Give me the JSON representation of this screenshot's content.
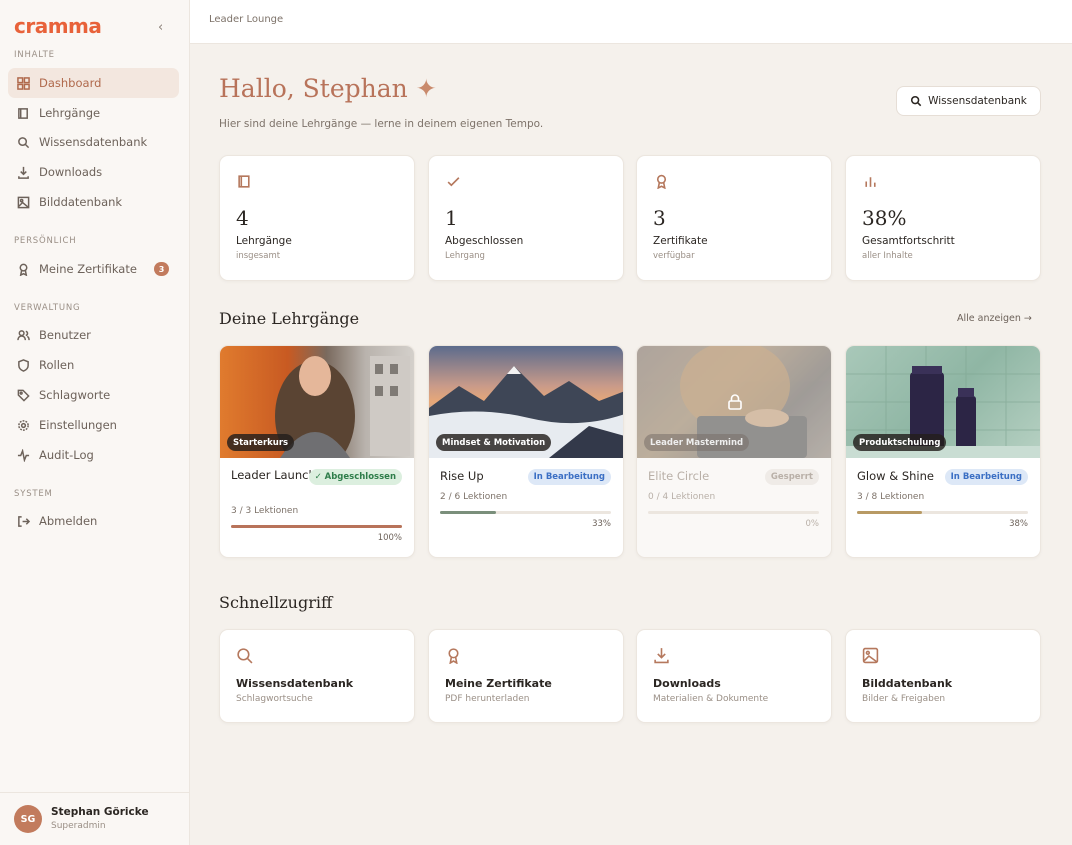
{
  "app": {
    "logo": "cramma",
    "collapse": "‹"
  },
  "sidebar": {
    "sections": [
      "INHALTE",
      "PERSÖNLICH",
      "VERWALTUNG",
      "SYSTEM"
    ],
    "items": [
      {
        "label": "Dashboard",
        "icon": "grid-icon"
      },
      {
        "label": "Lehrgänge",
        "icon": "book-icon"
      },
      {
        "label": "Wissensdatenbank",
        "icon": "search-icon"
      },
      {
        "label": "Downloads",
        "icon": "download-icon"
      },
      {
        "label": "Bilddatenbank",
        "icon": "image-icon"
      },
      {
        "label": "Meine Zertifikate",
        "icon": "award-icon",
        "badge": "3"
      },
      {
        "label": "Benutzer",
        "icon": "users-icon"
      },
      {
        "label": "Rollen",
        "icon": "shield-icon"
      },
      {
        "label": "Schlagworte",
        "icon": "tag-icon"
      },
      {
        "label": "Einstellungen",
        "icon": "gear-icon"
      },
      {
        "label": "Audit-Log",
        "icon": "activity-icon"
      },
      {
        "label": "Abmelden",
        "icon": "logout-icon"
      }
    ],
    "user": {
      "initials": "SG",
      "name": "Stephan Göricke",
      "role": "Superadmin"
    }
  },
  "topbar": {
    "breadcrumb": "Leader Lounge"
  },
  "header": {
    "greeting": "Hallo, Stephan",
    "spark": "✦",
    "subtitle": "Hier sind deine Lehrgänge — lerne in deinem eigenen Tempo.",
    "kb_button": "Wissensdatenbank"
  },
  "stats": [
    {
      "value": "4",
      "label": "Lehrgänge",
      "sub": "insgesamt",
      "icon": "book-icon"
    },
    {
      "value": "1",
      "label": "Abgeschlossen",
      "sub": "Lehrgang",
      "icon": "check-icon"
    },
    {
      "value": "3",
      "label": "Zertifikate",
      "sub": "verfügbar",
      "icon": "award-icon"
    },
    {
      "value": "38%",
      "label": "Gesamtfortschritt",
      "sub": "aller Inhalte",
      "icon": "bar-chart-icon"
    }
  ],
  "courses_section": {
    "title": "Deine Lehrgänge",
    "show_all": "Alle anzeigen →"
  },
  "courses": [
    {
      "tag": "Starterkurs",
      "title": "Leader Launch",
      "status": "✓ Abgeschlossen",
      "lessons": "3 / 3 Lektionen",
      "progress": 100,
      "pct": "100%"
    },
    {
      "tag": "Mindset & Motivation",
      "title": "Rise Up",
      "status": "In Bearbeitung",
      "lessons": "2 / 6 Lektionen",
      "progress": 33,
      "pct": "33%"
    },
    {
      "tag": "Leader Mastermind",
      "title": "Elite Circle",
      "status": "Gesperrt",
      "lessons": "0 / 4 Lektionen",
      "progress": 0,
      "pct": "0%"
    },
    {
      "tag": "Produktschulung",
      "title": "Glow & Shine",
      "status": "In Bearbeitung",
      "lessons": "3 / 8 Lektionen",
      "progress": 38,
      "pct": "38%"
    }
  ],
  "quick_section": {
    "title": "Schnellzugriff"
  },
  "quick": [
    {
      "title": "Wissensdatenbank",
      "sub": "Schlagwortsuche",
      "icon": "search-icon"
    },
    {
      "title": "Meine Zertifikate",
      "sub": "PDF herunterladen",
      "icon": "award-icon"
    },
    {
      "title": "Downloads",
      "sub": "Materialien & Dokumente",
      "icon": "download-icon"
    },
    {
      "title": "Bilddatenbank",
      "sub": "Bilder & Freigaben",
      "icon": "image-icon"
    }
  ],
  "colors": {
    "accent": "#b8735a",
    "logo": "#e8623a",
    "done": "#2e7d4a",
    "in_progress": "#3b6fc4"
  }
}
